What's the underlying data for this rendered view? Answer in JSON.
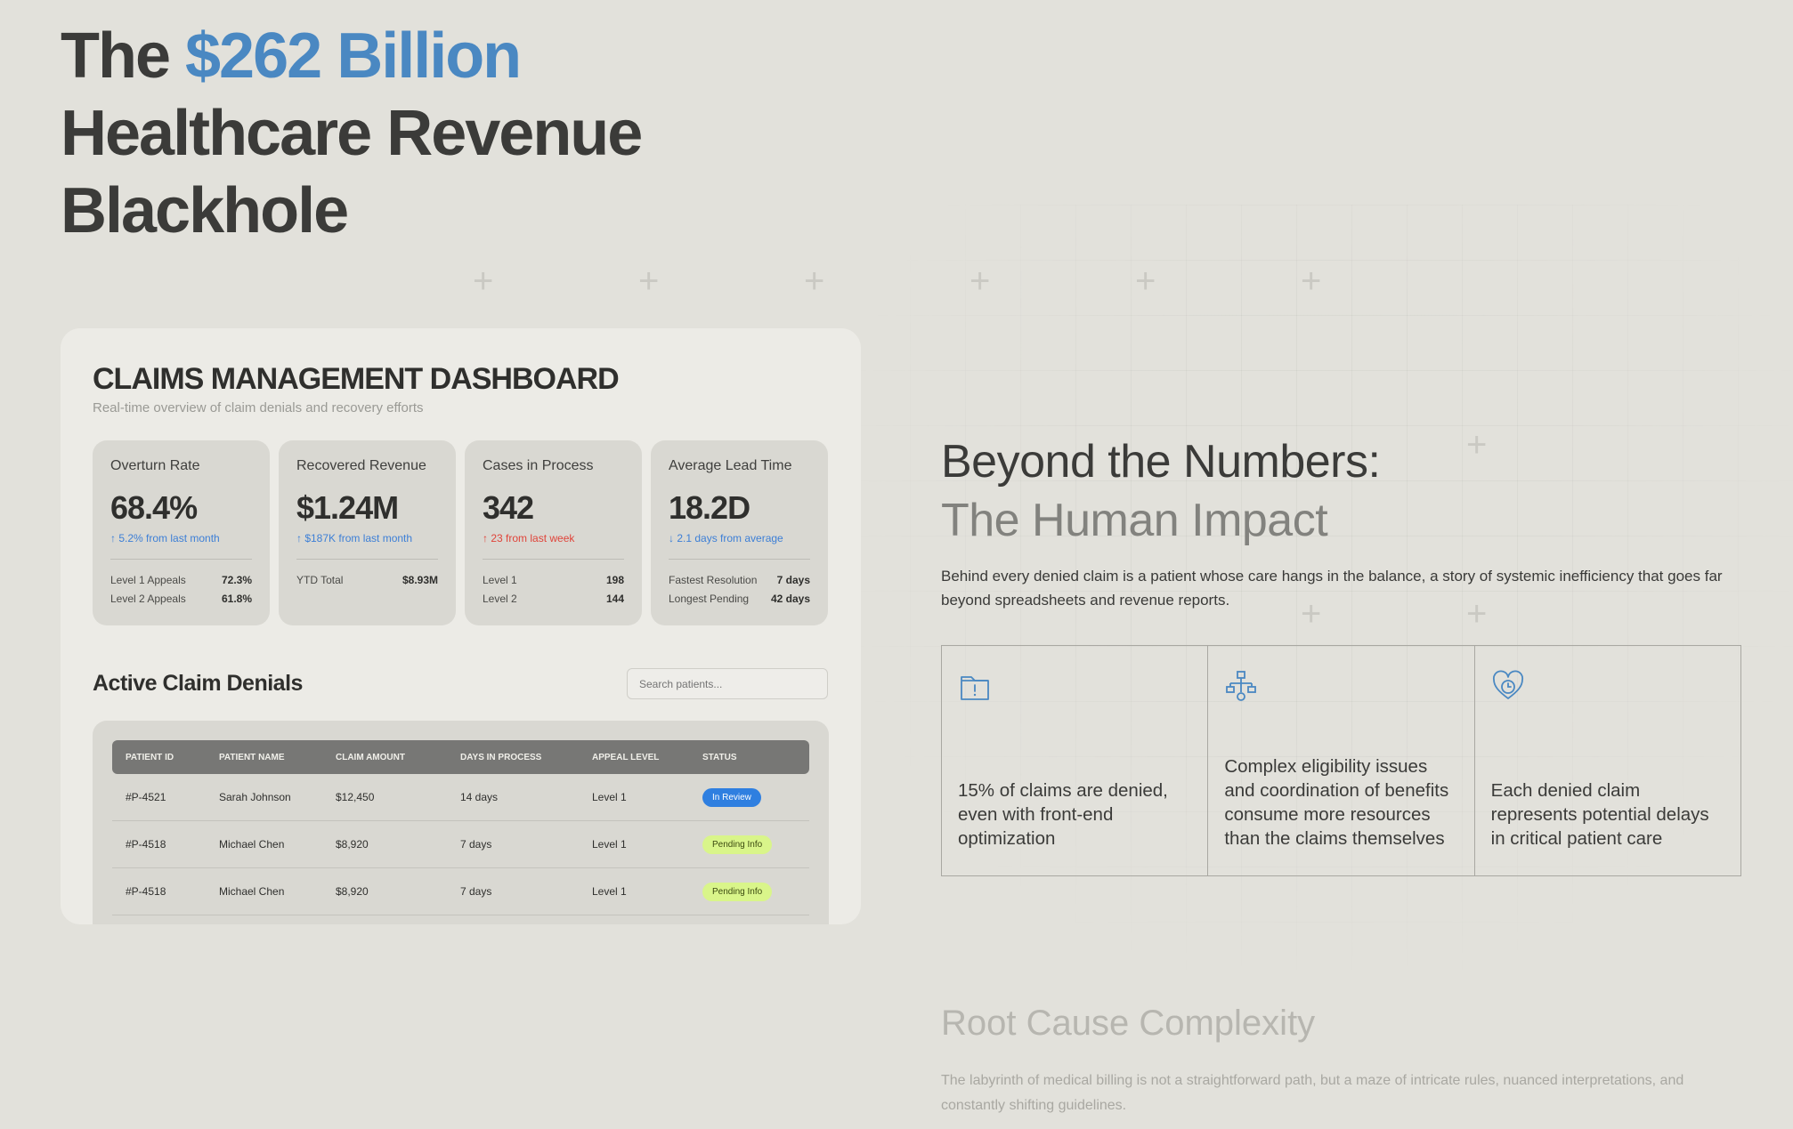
{
  "hero": {
    "line1_prefix": "The ",
    "line1_accent": "$262 Billion",
    "line2": "Healthcare Revenue",
    "line3": "Blackhole",
    "accent_color": "#4a88c2"
  },
  "dashboard": {
    "title": "CLAIMS MANAGEMENT DASHBOARD",
    "subtitle": "Real-time overview of claim denials and recovery efforts",
    "stats": [
      {
        "label": "Overturn Rate",
        "value": "68.4%",
        "change": "↑ 5.2% from last month",
        "change_type": "up",
        "rows": [
          {
            "label": "Level 1 Appeals",
            "value": "72.3%"
          },
          {
            "label": "Level 2 Appeals",
            "value": "61.8%"
          }
        ]
      },
      {
        "label": "Recovered Revenue",
        "value": "$1.24M",
        "change": "↑ $187K from last month",
        "change_type": "up",
        "rows": [
          {
            "label": "YTD Total",
            "value": "$8.93M"
          }
        ]
      },
      {
        "label": "Cases in Process",
        "value": "342",
        "change": "↑ 23 from last week",
        "change_type": "bad",
        "rows": [
          {
            "label": "Level 1",
            "value": "198"
          },
          {
            "label": "Level 2",
            "value": "144"
          }
        ]
      },
      {
        "label": "Average Lead Time",
        "value": "18.2D",
        "change": "↓ 2.1 days from average",
        "change_type": "down",
        "rows": [
          {
            "label": "Fastest Resolution",
            "value": "7 days"
          },
          {
            "label": "Longest Pending",
            "value": "42 days"
          }
        ]
      }
    ],
    "section_title": "Active Claim Denials",
    "search": {
      "placeholder": "Search patients..."
    },
    "table": {
      "columns": [
        "PATIENT ID",
        "PATIENT NAME",
        "CLAIM AMOUNT",
        "DAYS IN PROCESS",
        "APPEAL LEVEL",
        "STATUS"
      ],
      "rows": [
        {
          "id": "#P-4521",
          "name": "Sarah Johnson",
          "amount": "$12,450",
          "days": "14 days",
          "level": "Level 1",
          "status": "In Review",
          "status_type": "review"
        },
        {
          "id": "#P-4518",
          "name": "Michael Chen",
          "amount": "$8,920",
          "days": "7 days",
          "level": "Level 1",
          "status": "Pending Info",
          "status_type": "pending"
        },
        {
          "id": "#P-4518",
          "name": "Michael Chen",
          "amount": "$8,920",
          "days": "7 days",
          "level": "Level 1",
          "status": "Pending Info",
          "status_type": "pending"
        }
      ]
    }
  },
  "impact": {
    "title_line1": "Beyond the Numbers:",
    "title_line2": "The Human Impact",
    "paragraph": "Behind every denied claim is a patient whose care hangs in the balance, a story of systemic inefficiency that goes far beyond spreadsheets and revenue reports.",
    "cards": [
      {
        "icon": "folder-alert-icon",
        "text": "15% of claims are denied, even with front-end optimization"
      },
      {
        "icon": "hierarchy-icon",
        "text": "Complex eligibility issues and coordination of benefits consume more resources than the claims themselves"
      },
      {
        "icon": "heart-clock-icon",
        "text": "Each denied claim represents potential delays in critical patient care"
      }
    ]
  },
  "root_cause": {
    "title": "Root Cause Complexity",
    "paragraph": "The labyrinth of medical billing is not a straightforward path, but a maze of intricate rules, nuanced interpretations, and constantly shifting guidelines."
  },
  "colors": {
    "background": "#e2e1db",
    "accent_blue": "#4a88c2",
    "status_review": "#2f7fe0",
    "status_pending": "#d9f58a",
    "change_negative": "#e0443a"
  }
}
